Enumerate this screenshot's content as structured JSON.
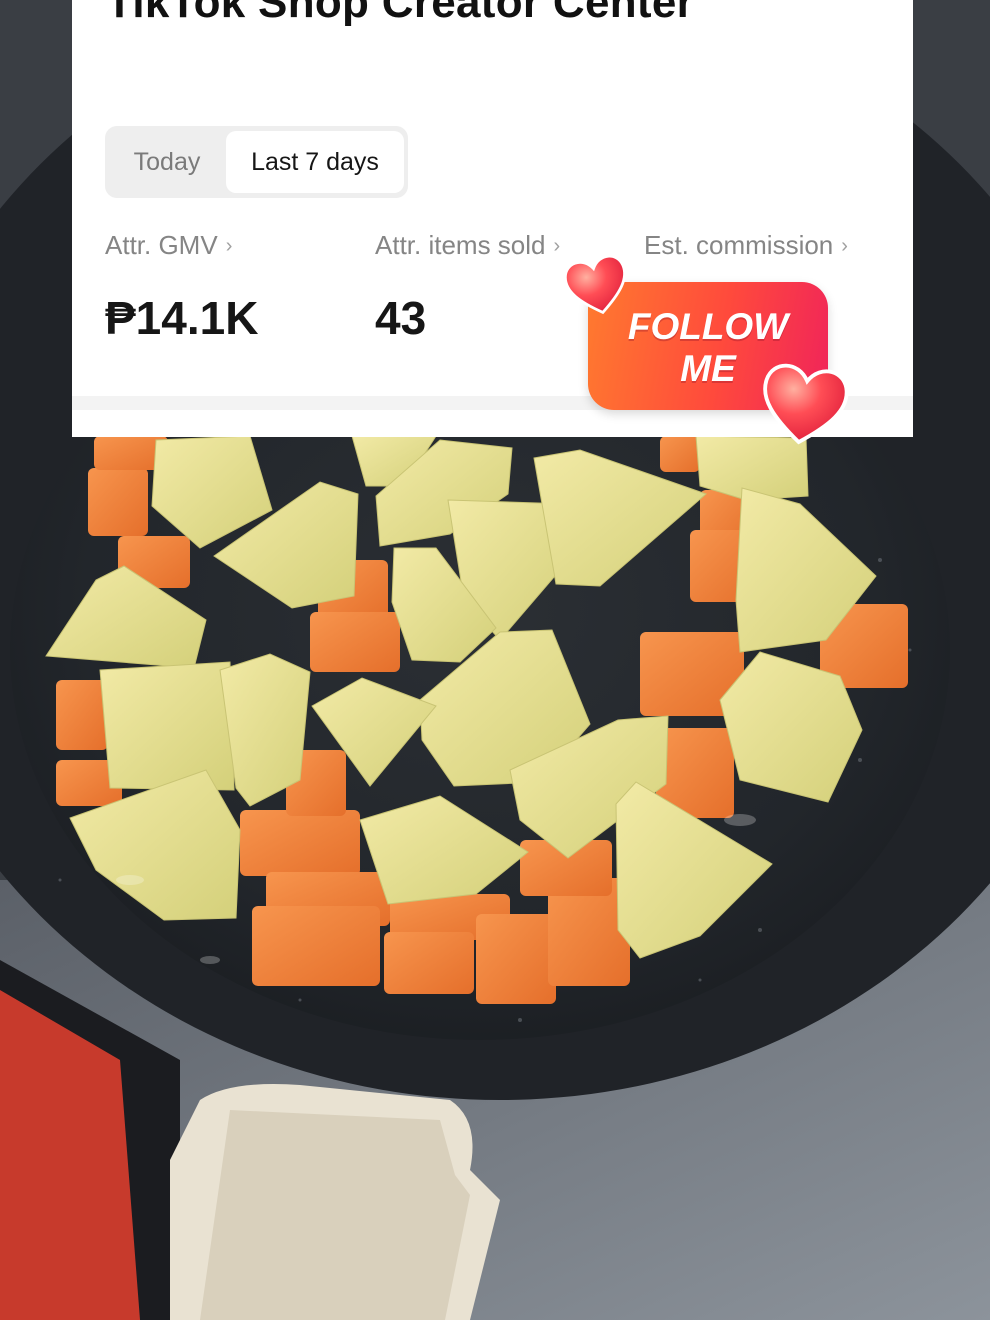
{
  "app": {
    "title": "TikTok Shop Creator Center"
  },
  "tabs": {
    "today": "Today",
    "last7": "Last 7 days",
    "selected": "last7"
  },
  "metrics": [
    {
      "label": "Attr. GMV",
      "value": "₱14.1K"
    },
    {
      "label": "Attr. items sold",
      "value": "43"
    },
    {
      "label": "Est. commission",
      "value": ""
    }
  ],
  "sticker": {
    "text": "FOLLOW\nME"
  },
  "colors": {
    "sticker_start": "#ff7a2f",
    "sticker_end": "#f0245a",
    "heart": "#ff3b4f"
  },
  "icons": {
    "chevron": "chevron-right-icon",
    "heart": "heart-icon"
  }
}
